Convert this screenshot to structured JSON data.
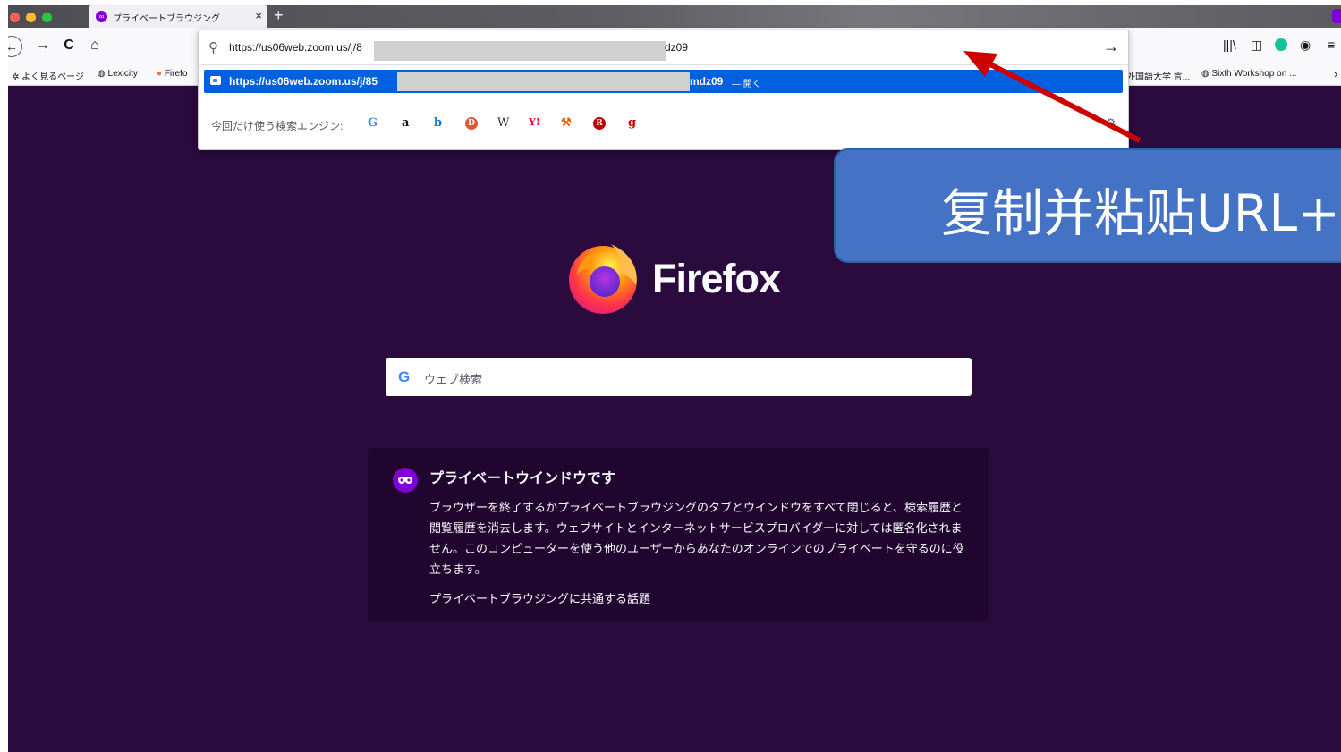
{
  "tab": {
    "title": "プライベートブラウジング",
    "close": "×",
    "new": "+"
  },
  "nav": {
    "back": "←",
    "forward": "→",
    "reload": "C",
    "home": "⌂"
  },
  "toolbar_icons": [
    "library-icon",
    "sidebar-icon",
    "grammarly-icon",
    "account-icon",
    "menu-icon"
  ],
  "bookmarks": {
    "left": [
      "よく見るページ",
      "Lexicity",
      "Firefo"
    ],
    "right": [
      "外国語大学 言...",
      "Sixth Workshop on ..."
    ],
    "overflow": "›"
  },
  "urlbar": {
    "value_start": "https://us06web.zoom.us/j/8",
    "value_end": "dz09",
    "go": "→"
  },
  "suggestion": {
    "url_start": "https://us06web.zoom.us/j/85",
    "url_end": "mdz09",
    "action": "— 開く"
  },
  "search_engines": {
    "label": "今回だけ使う検索エンジン:",
    "engines": [
      {
        "glyph": "G",
        "color": "#4285f4"
      },
      {
        "glyph": "a",
        "color": "#111111"
      },
      {
        "glyph": "b",
        "color": "#0078d4"
      },
      {
        "glyph": "D",
        "color": "#de5833"
      },
      {
        "glyph": "W",
        "color": "#333333"
      },
      {
        "glyph": "Y!",
        "color": "#ff0033"
      },
      {
        "glyph": "⚒",
        "color": "#e66000"
      },
      {
        "glyph": "R",
        "color": "#bf0000"
      },
      {
        "glyph": "g",
        "color": "#d50000"
      }
    ]
  },
  "brand": {
    "name": "Firefox"
  },
  "search": {
    "placeholder": "ウェブ検索",
    "g": "G"
  },
  "private_card": {
    "title": "プライベートウインドウです",
    "body": "ブラウザーを終了するかプライベートブラウジングのタブとウインドウをすべて閉じると、検索履歴と閲覧履歴を消去します。ウェブサイトとインターネットサービスプロバイダーに対しては匿名化されません。このコンピューターを使う他のユーザーからあなたのオンラインでのプライベートを守るのに役立ちます。",
    "link": "プライベートブラウジングに共通する話題"
  },
  "annotation": {
    "text": "复制并粘贴URL+",
    "color": "#4472c4",
    "arrow_color": "#cc0000"
  },
  "colors": {
    "page_bg": "#2b0a3d",
    "card_bg": "#20062f",
    "accent": "#0060df",
    "private": "#8000d7"
  }
}
